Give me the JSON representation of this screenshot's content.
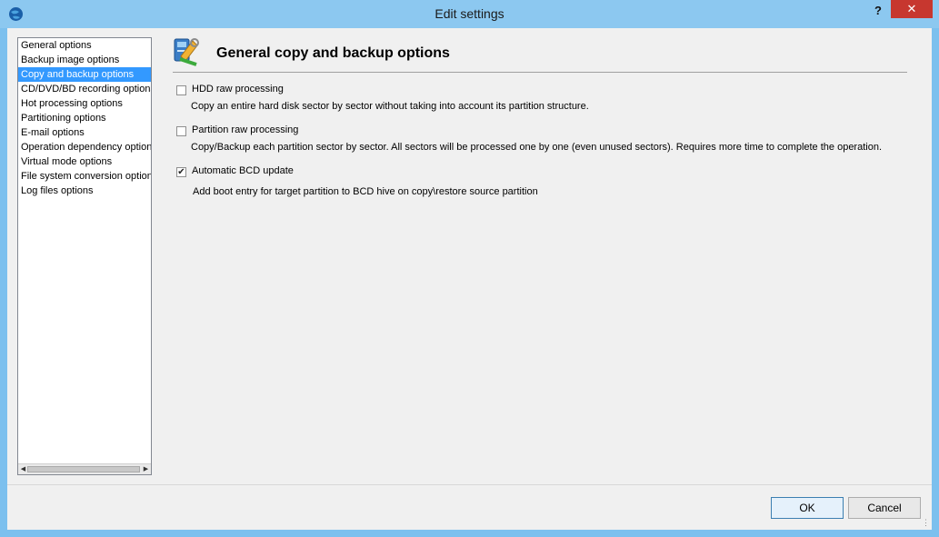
{
  "window": {
    "title": "Edit settings",
    "help": "?",
    "close": "✕"
  },
  "nav": {
    "items": [
      {
        "label": "General options"
      },
      {
        "label": "Backup image options"
      },
      {
        "label": "Copy and backup options"
      },
      {
        "label": "CD/DVD/BD recording options"
      },
      {
        "label": "Hot processing options"
      },
      {
        "label": "Partitioning options"
      },
      {
        "label": "E-mail options"
      },
      {
        "label": "Operation dependency options"
      },
      {
        "label": "Virtual mode options"
      },
      {
        "label": "File system conversion options"
      },
      {
        "label": "Log files options"
      }
    ],
    "selected_index": 2
  },
  "main": {
    "title": "General copy and backup options",
    "options": [
      {
        "label": "HDD raw processing",
        "checked": false,
        "description": "Copy an entire hard disk sector by sector without taking into account its partition structure."
      },
      {
        "label": "Partition raw processing",
        "checked": false,
        "description": "Copy/Backup each partition sector by sector. All sectors will be processed one by one (even unused sectors). Requires more time to complete the operation."
      },
      {
        "label": "Automatic BCD update",
        "checked": true,
        "description": "Add boot entry for target partition to BCD hive on copy\\restore source partition"
      }
    ]
  },
  "buttons": {
    "ok": "OK",
    "cancel": "Cancel"
  },
  "colors": {
    "selection": "#3399ff",
    "titlebar": "#8cc8f0",
    "close": "#c7372f"
  }
}
